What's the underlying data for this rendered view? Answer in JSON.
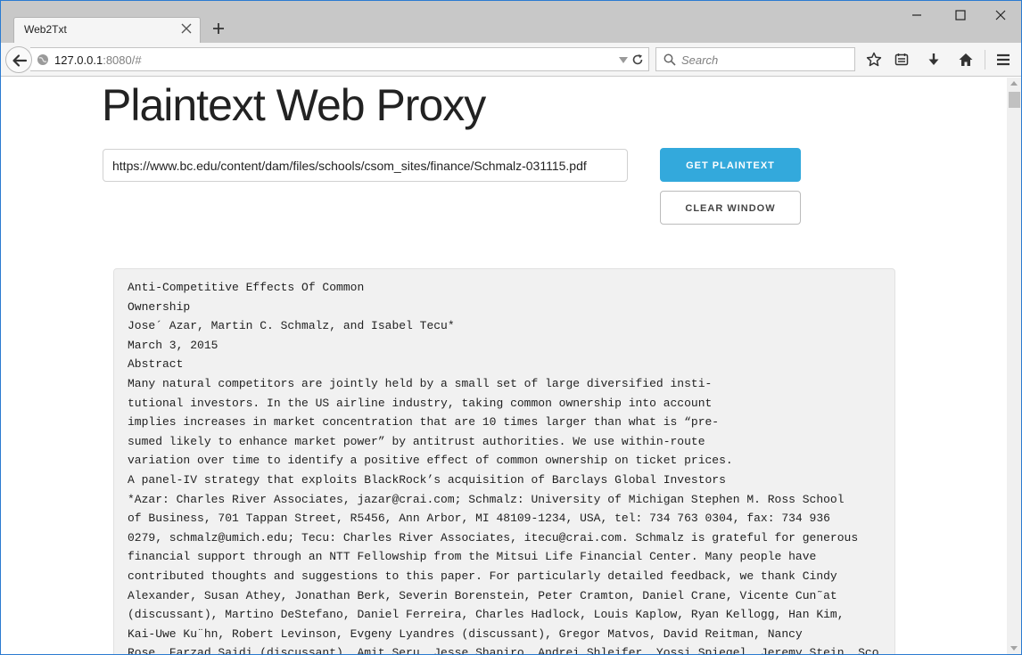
{
  "browser": {
    "tab_title": "Web2Txt",
    "url_host": "127.0.0.1",
    "url_rest": ":8080/#",
    "search_placeholder": "Search"
  },
  "page": {
    "title": "Plaintext Web Proxy",
    "url_value": "https://www.bc.edu/content/dam/files/schools/csom_sites/finance/Schmalz-031115.pdf",
    "get_button": "GET PLAINTEXT",
    "clear_button": "CLEAR WINDOW",
    "output_lines": [
      "Anti-Competitive Effects Of Common",
      "Ownership",
      "Jose´ Azar, Martin C. Schmalz, and Isabel Tecu*",
      "March 3, 2015",
      "Abstract",
      "Many natural competitors are jointly held by a small set of large diversified insti-",
      "tutional investors. In the US airline industry, taking common ownership into account",
      "implies increases in market concentration that are 10 times larger than what is “pre-",
      "sumed likely to enhance market power” by antitrust authorities. We use within-route",
      "variation over time to identify a positive effect of common ownership on ticket prices.",
      "A panel-IV strategy that exploits BlackRock’s acquisition of Barclays Global Investors",
      "*Azar: Charles River Associates, jazar@crai.com; Schmalz: University of Michigan Stephen M. Ross School",
      "of Business, 701 Tappan Street, R5456, Ann Arbor, MI 48109-1234, USA, tel: 734 763 0304, fax: 734 936",
      "0279, schmalz@umich.edu; Tecu: Charles River Associates, itecu@crai.com. Schmalz is grateful for generous",
      "financial support through an NTT Fellowship from the Mitsui Life Financial Center. Many people have",
      "contributed thoughts and suggestions to this paper. For particularly detailed feedback, we thank Cindy",
      "Alexander, Susan Athey, Jonathan Berk, Severin Borenstein, Peter Cramton, Daniel Crane, Vicente Cun˜at",
      "(discussant), Martino DeStefano, Daniel Ferreira, Charles Hadlock, Louis Kaplow, Ryan Kellogg, Han Kim,",
      "Kai-Uwe Ku¨hn, Robert Levinson, Evgeny Lyandres (discussant), Gregor Matvos, David Reitman, Nancy",
      "Rose, Farzad Saidi (discussant), Amit Seru, Jesse Shapiro, Andrei Shleifer, Yossi Spiegel, Jeremy Stein, Sco"
    ]
  },
  "colors": {
    "accent": "#33a9dc",
    "window_border": "#2b7bd1",
    "output_bg": "#f1f1f1"
  },
  "icons": [
    "back-arrow-icon",
    "globe-icon",
    "dropdown-icon",
    "reload-icon",
    "search-icon",
    "star-icon",
    "reader-icon",
    "download-icon",
    "home-icon",
    "menu-icon",
    "close-icon",
    "plus-icon",
    "minimize-icon",
    "maximize-icon"
  ]
}
